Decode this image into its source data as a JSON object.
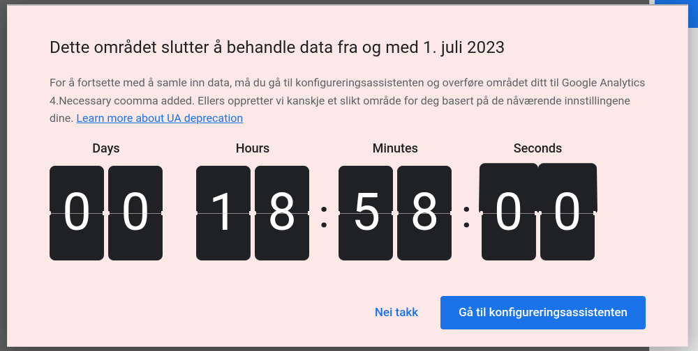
{
  "modal": {
    "title": "Dette området slutter å behandle data fra og med 1. juli 2023",
    "body_pre": "For å fortsette med å samle inn data, må du gå til konfigureringsassistenten og overføre området ditt til Google Analytics 4.Necessary coomma added. Ellers oppretter vi kanskje et slikt område for deg basert på de nåværende innstillingene dine. ",
    "link_text": "Learn more about UA deprecation"
  },
  "countdown": {
    "labels": {
      "days": "Days",
      "hours": "Hours",
      "minutes": "Minutes",
      "seconds": "Seconds"
    },
    "days": {
      "d1": "0",
      "d2": "0"
    },
    "hours": {
      "d1": "1",
      "d2": "8"
    },
    "minutes": {
      "d1": "5",
      "d2": "8"
    },
    "seconds": {
      "d1": "0",
      "d2": "0"
    }
  },
  "actions": {
    "dismiss": "Nei takk",
    "primary": "Gå til konfigureringsassistenten"
  }
}
